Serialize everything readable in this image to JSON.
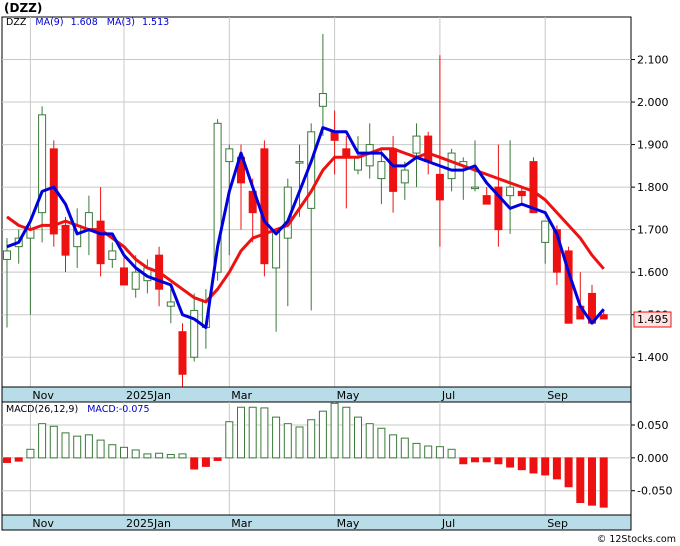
{
  "title": "(DZZ)",
  "credit": "© 12Stocks.com",
  "colors": {
    "ma_short": "#0000dd",
    "ma_long": "#ee1111",
    "up": "#3a7a3a",
    "down": "#ee1111",
    "axis_band": "#b8dde8"
  },
  "price_legend": {
    "ticker": "DZZ",
    "ma9_label": "MA(9)",
    "ma9_value": "1.608",
    "ma3_label": "MA(3)",
    "ma3_value": "1.513"
  },
  "macd_legend": {
    "label": "MACD(26,12,9)",
    "value_label": "MACD:-0.075"
  },
  "last_price_label": "1.495",
  "chart_data": [
    {
      "type": "candlestick",
      "panel": "price",
      "ylim": [
        1.33,
        2.2
      ],
      "y_ticks": [
        "2.100",
        "2.000",
        "1.900",
        "1.800",
        "1.700",
        "1.600",
        "1.500",
        "1.400"
      ],
      "y_tick_values": [
        2.1,
        2.0,
        1.9,
        1.8,
        1.7,
        1.6,
        1.5,
        1.4
      ],
      "x_labels": [
        "Nov",
        "2025Jan",
        "Mar",
        "May",
        "Jul",
        "Sep"
      ],
      "x_label_weeks": [
        2,
        10,
        19,
        28,
        37,
        46
      ],
      "weeks": 52,
      "ohlc": [
        [
          1.63,
          1.68,
          1.47,
          1.65
        ],
        [
          1.66,
          1.7,
          1.62,
          1.68
        ],
        [
          1.68,
          1.71,
          1.5,
          1.7
        ],
        [
          1.74,
          1.99,
          1.67,
          1.97
        ],
        [
          1.89,
          1.91,
          1.66,
          1.69
        ],
        [
          1.71,
          1.73,
          1.6,
          1.64
        ],
        [
          1.66,
          1.75,
          1.61,
          1.71
        ],
        [
          1.7,
          1.78,
          1.64,
          1.74
        ],
        [
          1.72,
          1.8,
          1.59,
          1.62
        ],
        [
          1.63,
          1.67,
          1.61,
          1.65
        ],
        [
          1.61,
          1.64,
          1.58,
          1.57
        ],
        [
          1.56,
          1.64,
          1.54,
          1.6
        ],
        [
          1.58,
          1.63,
          1.55,
          1.61
        ],
        [
          1.64,
          1.66,
          1.52,
          1.56
        ],
        [
          1.52,
          1.56,
          1.48,
          1.53
        ],
        [
          1.46,
          1.48,
          1.31,
          1.36
        ],
        [
          1.4,
          1.55,
          1.39,
          1.51
        ],
        [
          1.47,
          1.56,
          1.42,
          1.53
        ],
        [
          1.6,
          1.96,
          1.58,
          1.95
        ],
        [
          1.86,
          1.9,
          1.64,
          1.89
        ],
        [
          1.87,
          1.9,
          1.7,
          1.81
        ],
        [
          1.79,
          1.82,
          1.67,
          1.74
        ],
        [
          1.89,
          1.91,
          1.59,
          1.62
        ],
        [
          1.61,
          1.69,
          1.46,
          1.7
        ],
        [
          1.68,
          1.82,
          1.52,
          1.8
        ],
        [
          1.86,
          1.9,
          1.73,
          1.86
        ],
        [
          1.75,
          1.95,
          1.51,
          1.93
        ],
        [
          1.99,
          2.16,
          1.92,
          2.02
        ],
        [
          1.93,
          1.98,
          1.83,
          1.91
        ],
        [
          1.89,
          1.92,
          1.75,
          1.87
        ],
        [
          1.84,
          1.92,
          1.83,
          1.87
        ],
        [
          1.85,
          1.95,
          1.82,
          1.9
        ],
        [
          1.82,
          1.89,
          1.76,
          1.86
        ],
        [
          1.89,
          1.92,
          1.74,
          1.79
        ],
        [
          1.81,
          1.86,
          1.77,
          1.84
        ],
        [
          1.88,
          1.95,
          1.8,
          1.92
        ],
        [
          1.92,
          1.93,
          1.83,
          1.86
        ],
        [
          1.83,
          2.11,
          1.66,
          1.77
        ],
        [
          1.82,
          1.89,
          1.79,
          1.88
        ],
        [
          1.85,
          1.87,
          1.77,
          1.86
        ],
        [
          1.8,
          1.91,
          1.79,
          1.8
        ],
        [
          1.78,
          1.8,
          1.77,
          1.76
        ],
        [
          1.8,
          1.9,
          1.66,
          1.7
        ],
        [
          1.78,
          1.91,
          1.69,
          1.8
        ],
        [
          1.79,
          1.8,
          1.76,
          1.78
        ],
        [
          1.86,
          1.87,
          1.79,
          1.74
        ],
        [
          1.67,
          1.7,
          1.62,
          1.72
        ],
        [
          1.7,
          1.71,
          1.57,
          1.6
        ],
        [
          1.65,
          1.66,
          1.56,
          1.48
        ],
        [
          1.52,
          1.6,
          1.5,
          1.49
        ],
        [
          1.55,
          1.57,
          1.51,
          1.48
        ],
        [
          1.5,
          1.51,
          1.49,
          1.49
        ]
      ],
      "ma3": [
        1.66,
        1.67,
        1.72,
        1.79,
        1.8,
        1.76,
        1.69,
        1.7,
        1.69,
        1.69,
        1.64,
        1.61,
        1.59,
        1.58,
        1.57,
        1.5,
        1.49,
        1.47,
        1.66,
        1.79,
        1.88,
        1.8,
        1.72,
        1.69,
        1.72,
        1.79,
        1.86,
        1.94,
        1.93,
        1.93,
        1.88,
        1.88,
        1.88,
        1.85,
        1.85,
        1.87,
        1.86,
        1.85,
        1.84,
        1.84,
        1.85,
        1.81,
        1.78,
        1.75,
        1.76,
        1.75,
        1.74,
        1.69,
        1.6,
        1.52,
        1.48,
        1.513
      ],
      "ma9": [
        1.73,
        1.71,
        1.7,
        1.71,
        1.71,
        1.72,
        1.71,
        1.7,
        1.7,
        1.68,
        1.66,
        1.63,
        1.61,
        1.6,
        1.58,
        1.56,
        1.54,
        1.53,
        1.56,
        1.6,
        1.65,
        1.68,
        1.69,
        1.7,
        1.71,
        1.75,
        1.79,
        1.84,
        1.87,
        1.87,
        1.87,
        1.88,
        1.89,
        1.89,
        1.88,
        1.87,
        1.88,
        1.87,
        1.86,
        1.85,
        1.84,
        1.83,
        1.82,
        1.81,
        1.8,
        1.79,
        1.77,
        1.74,
        1.71,
        1.68,
        1.64,
        1.608
      ]
    },
    {
      "type": "bar",
      "panel": "macd",
      "ylim": [
        -0.087,
        0.085
      ],
      "y_ticks": [
        "0.050",
        "0.000",
        "-0.050"
      ],
      "y_tick_values": [
        0.05,
        0.0,
        -0.05
      ],
      "x_labels": [
        "Nov",
        "2025Jan",
        "Mar",
        "May",
        "Jul",
        "Sep"
      ],
      "values": [
        -0.007,
        -0.005,
        0.013,
        0.052,
        0.048,
        0.038,
        0.033,
        0.035,
        0.027,
        0.02,
        0.016,
        0.012,
        0.006,
        0.007,
        0.005,
        0.006,
        -0.017,
        -0.013,
        -0.004,
        0.055,
        0.077,
        0.077,
        0.076,
        0.062,
        0.052,
        0.047,
        0.058,
        0.071,
        0.083,
        0.077,
        0.062,
        0.052,
        0.045,
        0.035,
        0.03,
        0.022,
        0.018,
        0.017,
        0.013,
        -0.009,
        -0.006,
        -0.006,
        -0.009,
        -0.014,
        -0.018,
        -0.023,
        -0.026,
        -0.032,
        -0.044,
        -0.068,
        -0.072,
        -0.075
      ]
    }
  ]
}
